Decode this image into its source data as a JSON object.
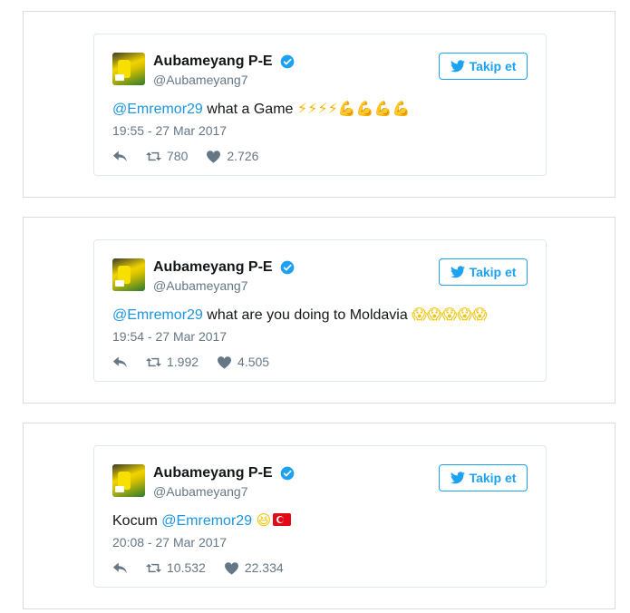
{
  "accent_color": "#1da1f2",
  "tweets": [
    {
      "name": "Aubameyang P-E",
      "handle": "@Aubameyang7",
      "follow_label": "Takip et",
      "pre_text": "",
      "mention": "@Emremor29",
      "post_text": " what a Game ",
      "emoji_a": "⚡⚡⚡⚡",
      "emoji_b": "💪💪💪💪",
      "timestamp": "19:55 - 27 Mar 2017",
      "retweets": "780",
      "likes": "2.726"
    },
    {
      "name": "Aubameyang P-E",
      "handle": "@Aubameyang7",
      "follow_label": "Takip et",
      "pre_text": "",
      "mention": "@Emremor29",
      "post_text": " what are you doing to Moldavia ",
      "emoji_a": "😱😱😱😱😱",
      "emoji_b": "",
      "timestamp": "19:54 - 27 Mar 2017",
      "retweets": "1.992",
      "likes": "4.505"
    },
    {
      "name": "Aubameyang P-E",
      "handle": "@Aubameyang7",
      "follow_label": "Takip et",
      "pre_text": "Kocum ",
      "mention": "@Emremor29",
      "post_text": " ",
      "emoji_a": "😆",
      "emoji_b": "",
      "timestamp": "20:08 - 27 Mar 2017",
      "retweets": "10.532",
      "likes": "22.334"
    }
  ]
}
